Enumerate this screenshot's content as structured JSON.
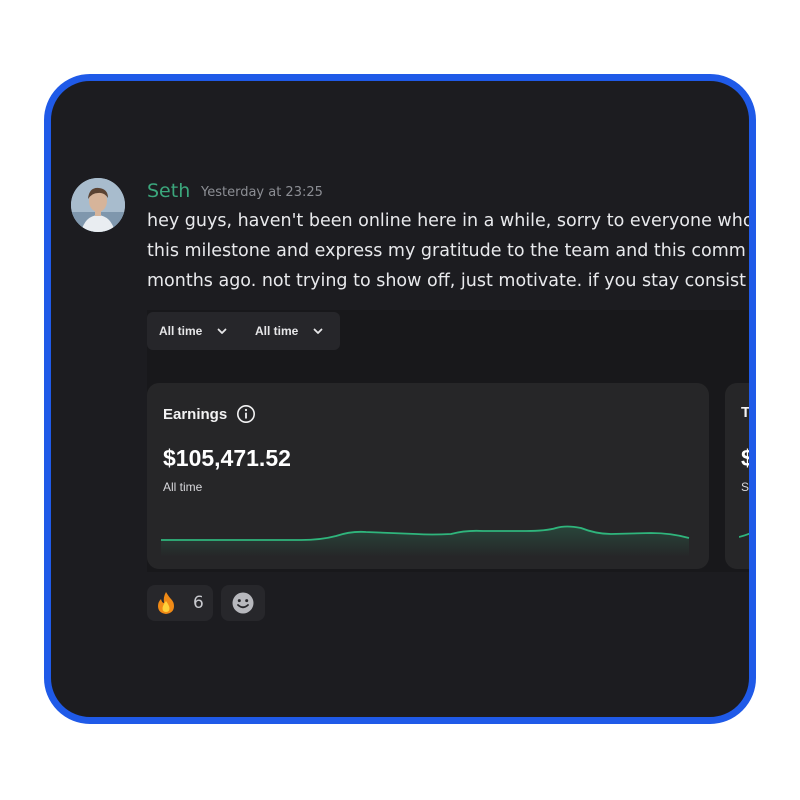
{
  "message": {
    "author": "Seth",
    "timestamp": "Yesterday at 23:25",
    "lines": [
      "hey guys, haven't been online here in a while, sorry to everyone who",
      "this milestone and express my gratitude to the team and this comm",
      "months ago. not trying to show off, just motivate. if you stay consist"
    ]
  },
  "embed": {
    "filters": [
      "All time",
      "All time"
    ],
    "cards": [
      {
        "title": "Earnings",
        "amount": "$105,471.52",
        "period": "All time",
        "trend_color": "#2fb57c"
      },
      {
        "title": "Th",
        "amount": "$",
        "period": "Se"
      }
    ]
  },
  "reactions": {
    "fire_count": "6"
  },
  "colors": {
    "frame_border": "#1f5ae8",
    "background": "#1c1c20",
    "username": "#3ba67c",
    "accent_green": "#2fb57c"
  },
  "icons": [
    "info-icon",
    "chevron-down-icon",
    "fire-emoji-icon",
    "add-reaction-icon"
  ]
}
